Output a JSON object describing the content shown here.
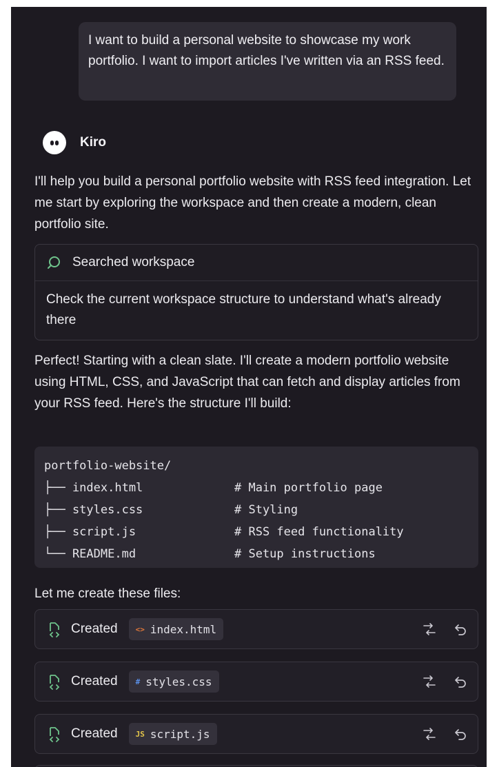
{
  "user_message": "I want to build a personal website to showcase my work portfolio. I want to import articles I've written via an RSS feed.",
  "agent": {
    "name": "Kiro"
  },
  "intro": "I'll help you build a personal portfolio website with RSS feed integration. Let me start by exploring the workspace and then create a modern, clean portfolio site.",
  "search_card": {
    "title": "Searched workspace",
    "body": "Check the current workspace structure to understand what's already there"
  },
  "plan_text": "Perfect! Starting with a clean slate. I'll create a modern portfolio website using HTML, CSS, and JavaScript that can fetch and display articles from your RSS feed. Here's the structure I'll build:",
  "code_block": {
    "root": "portfolio-website/",
    "rows": [
      {
        "tree": "├── index.html",
        "comment": "# Main portfolio page"
      },
      {
        "tree": "├── styles.css",
        "comment": "# Styling"
      },
      {
        "tree": "├── script.js",
        "comment": "# RSS feed functionality"
      },
      {
        "tree": "└── README.md",
        "comment": "# Setup instructions"
      }
    ]
  },
  "create_text": "Let me create these files:",
  "file_rows": [
    {
      "action": "Created",
      "filename": "index.html",
      "file_icon": "<>",
      "icon_color": "#e0783a"
    },
    {
      "action": "Created",
      "filename": "styles.css",
      "file_icon": "#",
      "icon_color": "#5a8fe6"
    },
    {
      "action": "Created",
      "filename": "script.js",
      "file_icon": "JS",
      "icon_color": "#e3c54a"
    }
  ],
  "colors": {
    "accent_green": "#6fc48c",
    "panel_bg": "#1d1a21"
  }
}
